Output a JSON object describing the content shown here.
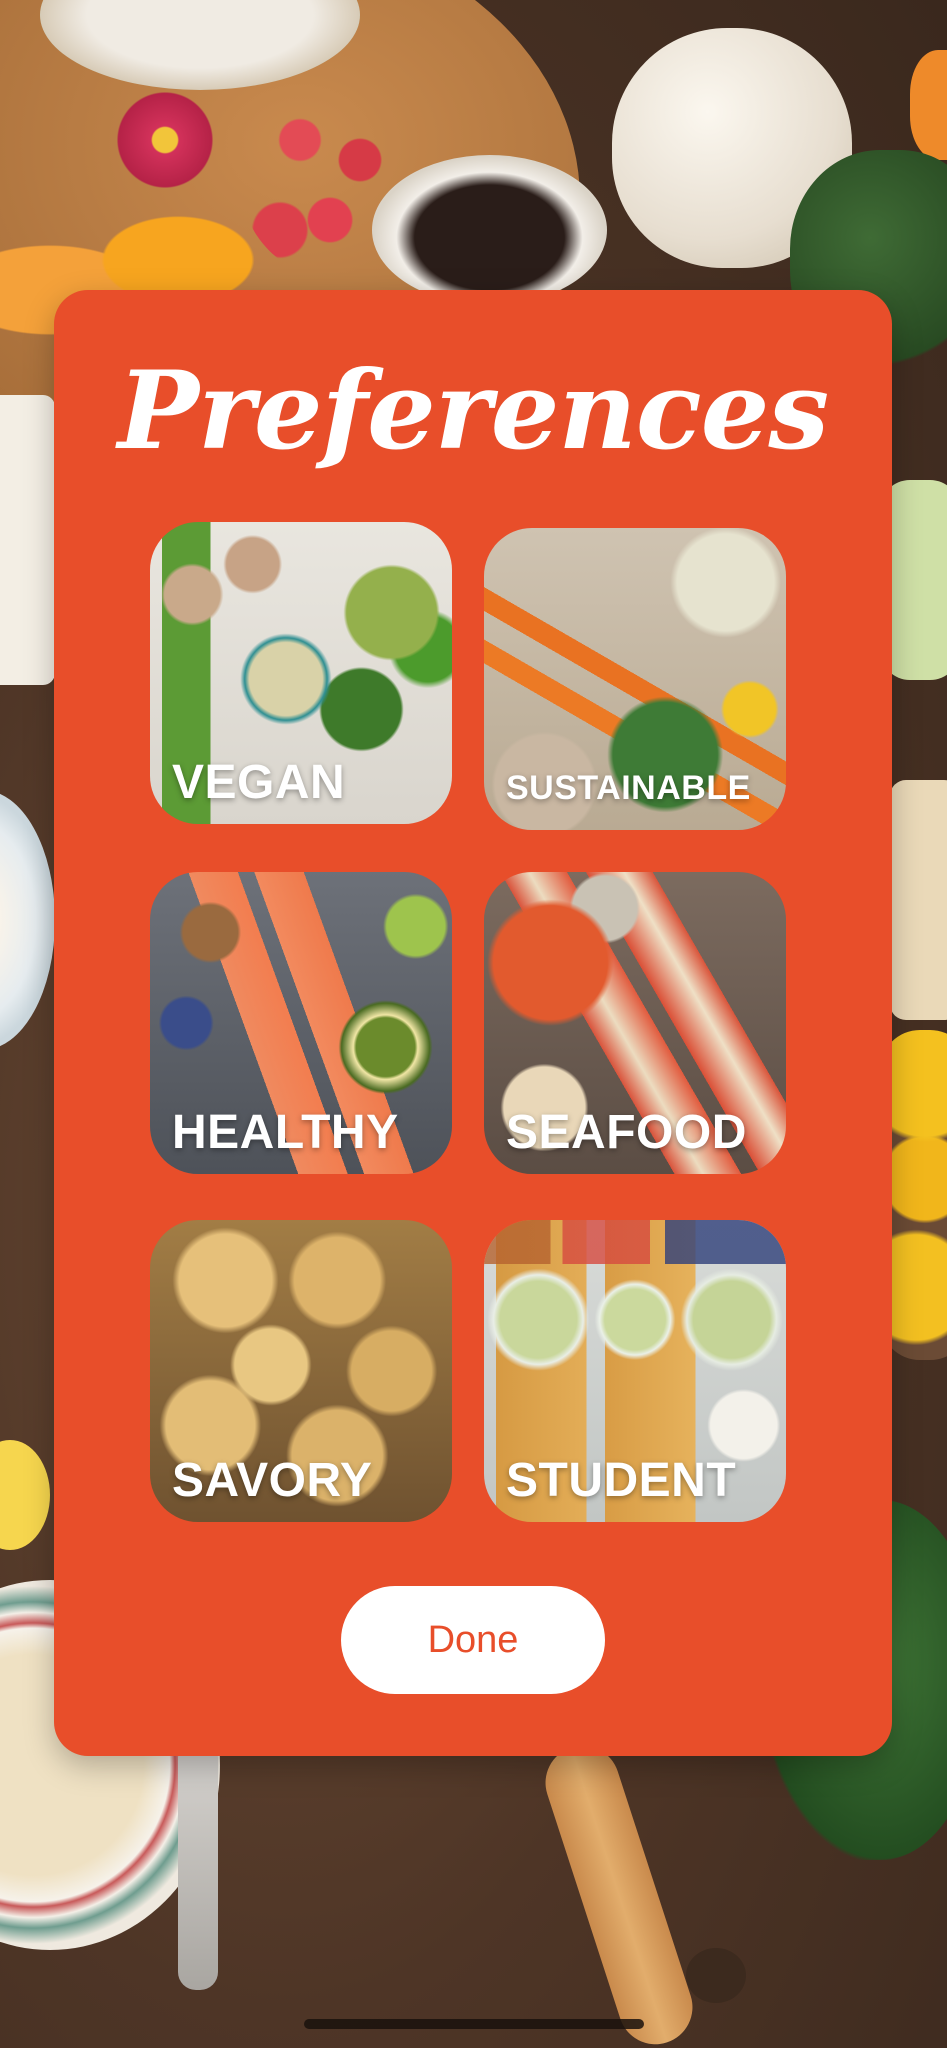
{
  "screen": {
    "title": "Preferences",
    "accent_color": "#e84e2a"
  },
  "preferences": [
    {
      "id": "vegan",
      "label": "VEGAN",
      "image": "vegetables-and-legumes-photo"
    },
    {
      "id": "sustainable",
      "label": "SUSTAINABLE",
      "image": "carrots-and-produce-photo"
    },
    {
      "id": "healthy",
      "label": "HEALTHY",
      "image": "salmon-and-superfoods-photo"
    },
    {
      "id": "seafood",
      "label": "SEAFOOD",
      "image": "lobster-and-shellfish-photo"
    },
    {
      "id": "savory",
      "label": "SAVORY",
      "image": "cheesy-bread-bake-photo"
    },
    {
      "id": "student",
      "label": "STUDENT",
      "image": "meal-prep-containers-photo"
    }
  ],
  "actions": {
    "done_label": "Done"
  },
  "background": {
    "image": "food-spread-table-photo"
  }
}
